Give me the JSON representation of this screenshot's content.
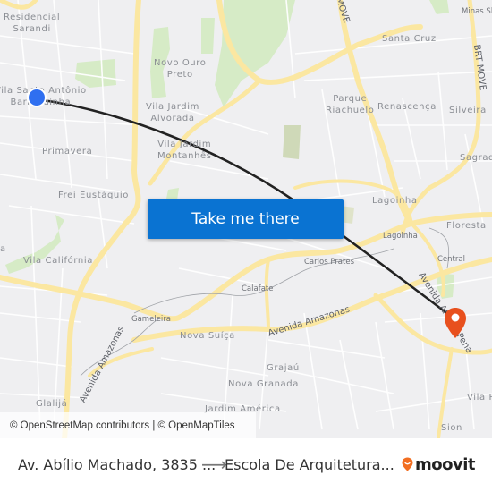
{
  "map": {
    "colors": {
      "background": "#efeff1",
      "park": "#d6ebc6",
      "major_road": "#fbe7a1",
      "minor_road": "#ffffff",
      "route_line": "#222222",
      "origin": "#2f6ff0",
      "destination": "#e8501e",
      "button": "#0a73d2"
    },
    "places": [
      {
        "id": "residencial-sarandi",
        "label": "Residencial\nSarandi"
      },
      {
        "id": "vila-santo-antonio",
        "label": "Vila Santo Antônio\nBarroquinha"
      },
      {
        "id": "primavera",
        "label": "Primavera"
      },
      {
        "id": "frei-eustaquio",
        "label": "Frei Eustáquio"
      },
      {
        "id": "vila-california",
        "label": "Vila Califórnia"
      },
      {
        "id": "novo-ouro-preto",
        "label": "Novo Ouro\nPreto"
      },
      {
        "id": "vila-jardim-alvorada",
        "label": "Vila Jardim\nAlvorada"
      },
      {
        "id": "vila-jardim-montanhes",
        "label": "Vila Jardim\nMontanhês"
      },
      {
        "id": "santa-cruz",
        "label": "Santa Cruz"
      },
      {
        "id": "parque-riachuelo",
        "label": "Parque\nRiachuelo"
      },
      {
        "id": "renascenca",
        "label": "Renascença"
      },
      {
        "id": "silveira",
        "label": "Silveira"
      },
      {
        "id": "sagrada",
        "label": "Sagrad"
      },
      {
        "id": "minas",
        "label": "Minas Sh"
      },
      {
        "id": "lagoinha-1",
        "label": "Lagoinha"
      },
      {
        "id": "floresta",
        "label": "Floresta"
      },
      {
        "id": "nova-suica",
        "label": "Nova Suíça"
      },
      {
        "id": "grajau",
        "label": "Grajaú"
      },
      {
        "id": "nova-granada",
        "label": "Nova Granada"
      },
      {
        "id": "jardim-america",
        "label": "Jardim América"
      },
      {
        "id": "vila-p",
        "label": "Vila P"
      },
      {
        "id": "sion",
        "label": "Sion"
      },
      {
        "id": "glalija",
        "label": "Glalijá"
      },
      {
        "id": "edge-a",
        "label": "a"
      }
    ],
    "small_places": [
      {
        "id": "lagoinha-2",
        "label": "Lagoinha"
      },
      {
        "id": "carlos-prates",
        "label": "Carlos Prates"
      },
      {
        "id": "calafate",
        "label": "Calafate"
      },
      {
        "id": "gameleira",
        "label": "Gameleira"
      },
      {
        "id": "central",
        "label": "Central"
      }
    ],
    "road_labels": [
      {
        "id": "avenida-amazonas-main",
        "label": "Avenida Amazonas"
      },
      {
        "id": "avenida-amazonas-sw",
        "label": "Avenida Amazonas"
      },
      {
        "id": "avenida-afonso-pena",
        "label": "Avenida Afonso Pena"
      },
      {
        "id": "brt-move-right",
        "label": "BRT MOVE"
      },
      {
        "id": "move-top",
        "label": "MOVE"
      }
    ],
    "cta_label": "Take me there",
    "attribution": "© OpenStreetMap contributors | © OpenMapTiles",
    "icons": {
      "origin": "origin-marker-icon",
      "destination": "destination-pin-icon"
    }
  },
  "footer": {
    "from": "Av. Abílio Machado, 3835 ...",
    "arrow": "⟶",
    "to": "Escola De Arquitetura...",
    "logo_text": "moovit",
    "logo_color": "#f26e21"
  }
}
